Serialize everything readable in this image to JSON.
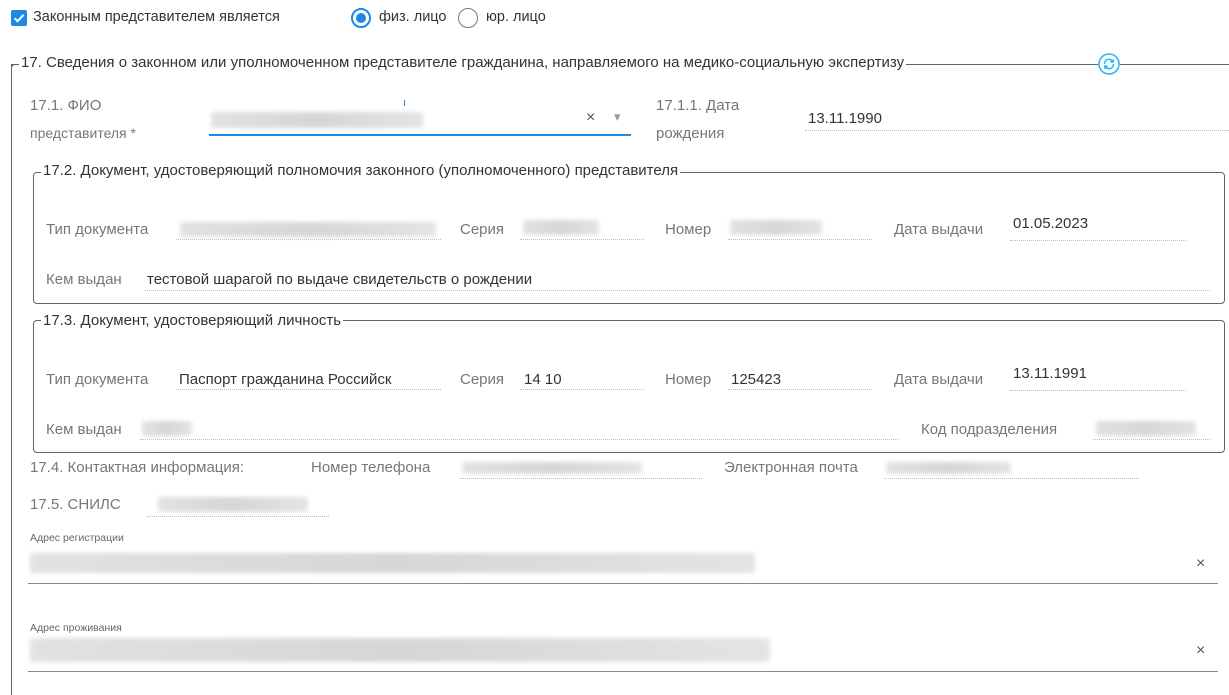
{
  "top": {
    "checkbox_label": "Законным представителем является",
    "radio_physical": "физ. лицо",
    "radio_legal": "юр. лицо"
  },
  "section17": {
    "legend": "17. Сведения о законном или уполномоченном представителе гражданина, направляемого на медико-социальную экспертизу",
    "fio_label_1": "17.1. ФИО",
    "fio_label_2": "представителя *",
    "dob_label_1": "17.1.1. Дата",
    "dob_label_2": "рождения",
    "dob_value": "13.11.1990"
  },
  "doc172": {
    "legend": "17.2. Документ, удостоверяющий полномочия законного (уполномоченного) представителя",
    "type_label": "Тип документа",
    "series_label": "Серия",
    "number_label": "Номер",
    "date_label": "Дата выдачи",
    "date_value": "01.05.2023",
    "issued_label": "Кем выдан",
    "issued_value": "тестовой шарагой по выдаче свидетельств о рождении"
  },
  "doc173": {
    "legend": "17.3. Документ, удостоверяющий личность",
    "type_label": "Тип документа",
    "type_value": "Паспорт гражданина Российск",
    "series_label": "Серия",
    "series_value": "14 10",
    "number_label": "Номер",
    "number_value": "125423",
    "date_label": "Дата выдачи",
    "date_value": "13.11.1991",
    "issued_label": "Кем выдан",
    "code_label": "Код подразделения"
  },
  "contact": {
    "label": "17.4. Контактная информация:",
    "phone_label": "Номер телефона",
    "email_label": "Электронная почта"
  },
  "snils": {
    "label": "17.5. СНИЛС"
  },
  "addresses": {
    "reg_label": "Адрес регистрации",
    "live_label": "Адрес проживания"
  },
  "icons": {
    "clear": "×",
    "dropdown": "▾"
  },
  "colors": {
    "accent": "#1e88e5",
    "checkbox": "#1e88e5",
    "refresh": "#29b6f6"
  }
}
